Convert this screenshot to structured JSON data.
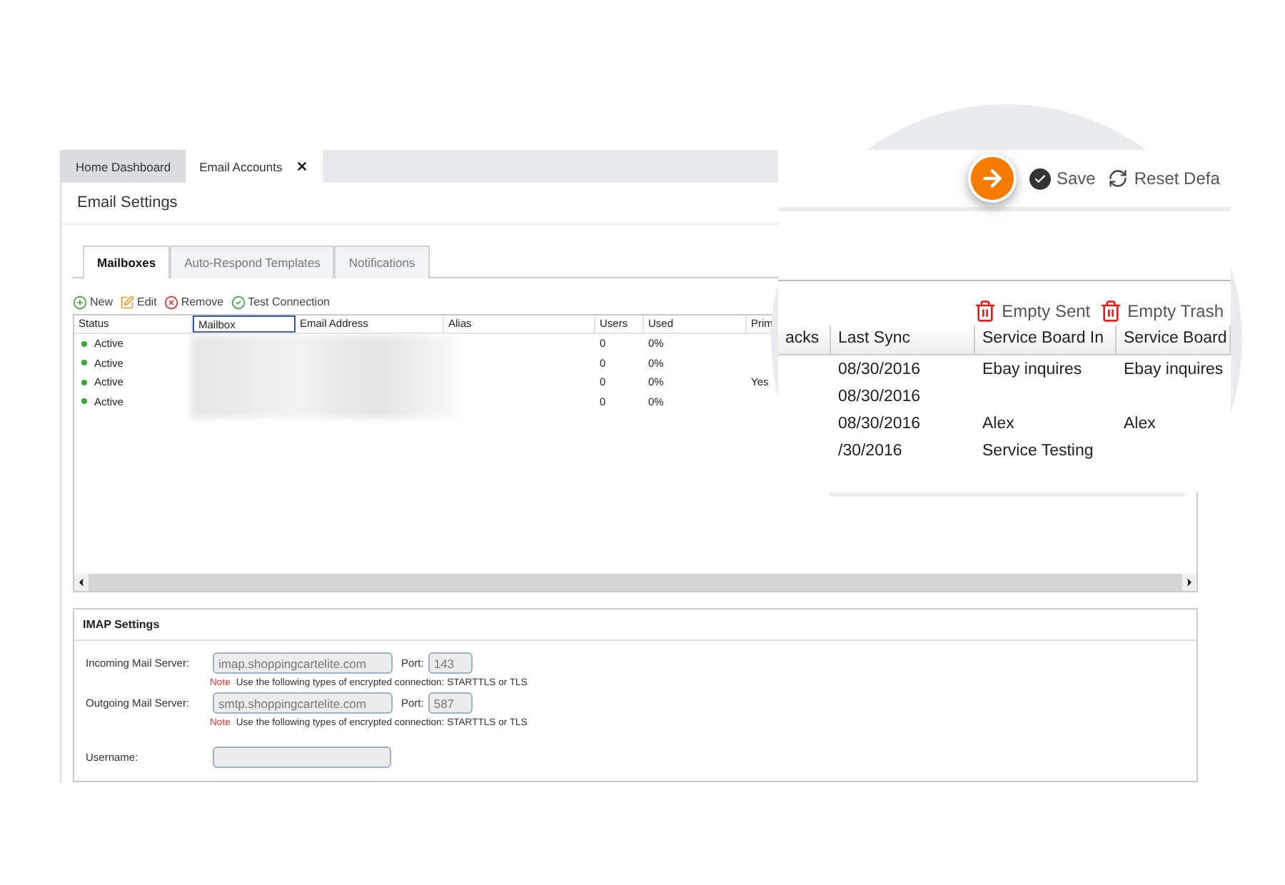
{
  "window_tabs": [
    {
      "label": "Home Dashboard",
      "selected": false,
      "closable": false
    },
    {
      "label": "Email Accounts",
      "selected": true,
      "closable": true
    }
  ],
  "page_title": "Email Settings",
  "section_tabs": [
    {
      "label": "Mailboxes",
      "selected": true
    },
    {
      "label": "Auto-Respond Templates",
      "selected": false
    },
    {
      "label": "Notifications",
      "selected": false
    }
  ],
  "toolbar": [
    {
      "label": "New",
      "kind": "new"
    },
    {
      "label": "Edit",
      "kind": "edit"
    },
    {
      "label": "Remove",
      "kind": "remove"
    },
    {
      "label": "Test Connection",
      "kind": "test"
    }
  ],
  "mailboxes": {
    "columns": [
      {
        "label": "Status",
        "focused": false
      },
      {
        "label": "Mailbox",
        "focused": true
      },
      {
        "label": "Email Address",
        "focused": false
      },
      {
        "label": "Alias",
        "focused": false
      },
      {
        "label": "Users",
        "focused": false
      },
      {
        "label": "Used",
        "focused": false
      },
      {
        "label": "Prim",
        "focused": false
      }
    ],
    "rows": [
      {
        "status": "Active",
        "users": "0",
        "used": "0%"
      },
      {
        "status": "Active",
        "users": "0",
        "used": "0%"
      },
      {
        "status": "Active",
        "users": "0",
        "used": "0%",
        "primary": "Yes"
      },
      {
        "status": "Active",
        "users": "0",
        "used": "0%"
      }
    ]
  },
  "imap": {
    "title": "IMAP Settings",
    "servers": [
      {
        "label": "Incoming Mail Server:",
        "value": "imap.shoppingcartelite.com",
        "port_label": "Port:",
        "port": "143",
        "note_label": "Note",
        "note": "Use the following types of encrypted connection: STARTTLS  or TLS"
      },
      {
        "label": "Outgoing Mail Server:",
        "value": "smtp.shoppingcartelite.com",
        "port_label": "Port:",
        "port": "587",
        "note_label": "Note",
        "note": "Use the following types of encrypted connection: STARTTLS or TLS"
      }
    ],
    "username_label": "Username:"
  },
  "magnified": {
    "actions": [
      {
        "label": "Save",
        "kind": "save"
      },
      {
        "label": "Reset Defa",
        "kind": "reset"
      }
    ],
    "mail_actions": [
      {
        "label": "Empty Sent"
      },
      {
        "label": "Empty Trash"
      }
    ],
    "columns": [
      "acks",
      "Last Sync",
      "Service Board In",
      "Service Board"
    ],
    "rows": [
      {
        "cells": [
          "",
          "08/30/2016",
          "Ebay inquires",
          "Ebay inquires"
        ]
      },
      {
        "cells": [
          "",
          "08/30/2016"
        ]
      },
      {
        "cells": [
          "",
          "08/30/2016",
          "Alex",
          "Alex"
        ]
      },
      {
        "cells": [
          "",
          "/30/2016",
          "Service Testing"
        ]
      }
    ]
  }
}
